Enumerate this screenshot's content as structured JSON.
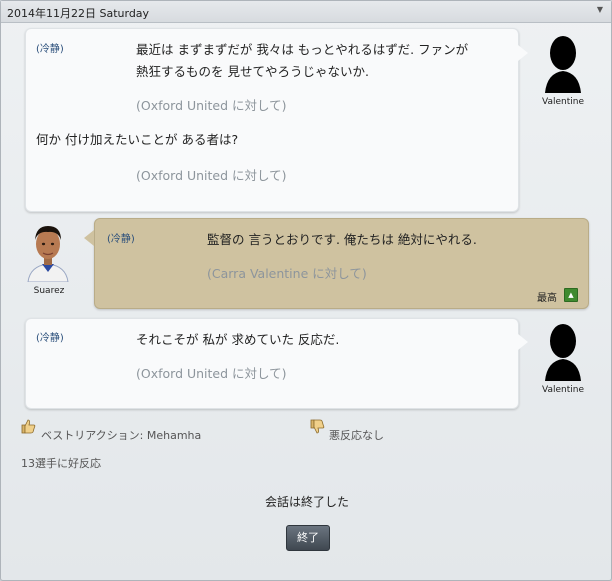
{
  "header": {
    "date": "2014年11月22日 Saturday"
  },
  "messages": [
    {
      "tone": "(冷静)",
      "lines": [
        "最近は まずまずだが 我々は もっとやれるはずだ. ファンが",
        "熱狂するものを 見せてやろうじゃないか."
      ],
      "context": "(Oxford United に対して)",
      "followup": "何か 付け加えたいことが ある者は?",
      "followup_context": "(Oxford United に対して)",
      "speaker": "Valentine"
    },
    {
      "tone": "(冷静)",
      "lines": [
        "監督の 言うとおりです. 俺たちは 絶対にやれる."
      ],
      "context": "(Carra Valentine に対して)",
      "speaker": "Suarez",
      "rating": "最高",
      "rating_icon": "up-arrow-icon"
    },
    {
      "tone": "(冷静)",
      "lines": [
        "それこそが 私が 求めていた 反応だ."
      ],
      "context": "(Oxford United に対して)",
      "speaker": "Valentine"
    }
  ],
  "footer": {
    "best_reaction": "ベストリアクション: Mehamha",
    "bad_reaction": "悪反応なし",
    "good_count": "13選手に好反応"
  },
  "end": {
    "message": "会話は終了した",
    "button_label": "終了"
  },
  "colors": {
    "tone_text": "#2a4e7a",
    "tan_bubble": "#cfc2a0",
    "rating_green": "#3f8a2f"
  }
}
